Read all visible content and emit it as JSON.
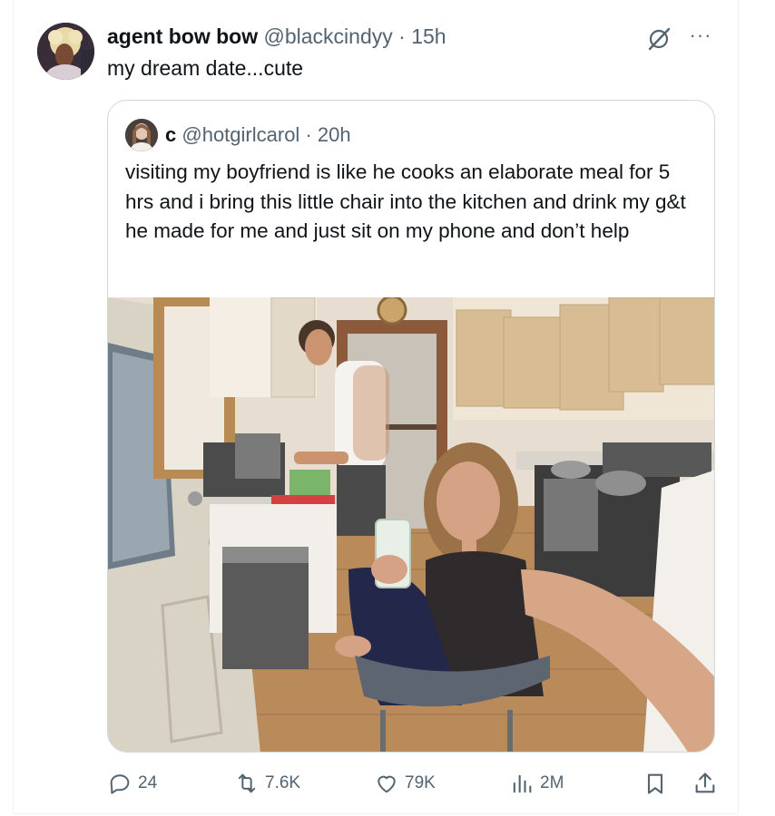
{
  "tweet": {
    "display_name": "agent bow bow",
    "handle": "@blackcindyy",
    "separator": "·",
    "time": "15h",
    "text": "my dream date...cute"
  },
  "quoted_tweet": {
    "display_name": "c",
    "handle": "@hotgirlcarol",
    "separator": "·",
    "time": "20h",
    "text": "visiting my boyfriend is like he cooks an elaborate meal for 5 hrs and i bring this little chair into the kitchen and drink my g&t he made for me and just sit on my phone and don’t help"
  },
  "actions": {
    "replies": "24",
    "reposts": "7.6K",
    "likes": "79K",
    "views": "2M"
  },
  "icons": {
    "grok": "grok-icon",
    "more": "more-dots-icon",
    "reply": "reply-icon",
    "repost": "repost-icon",
    "like": "heart-icon",
    "views": "views-icon",
    "bookmark": "bookmark-icon",
    "share": "share-icon"
  },
  "colors": {
    "text": "#0f1419",
    "secondary": "#536471",
    "border": "#cfd9de"
  }
}
